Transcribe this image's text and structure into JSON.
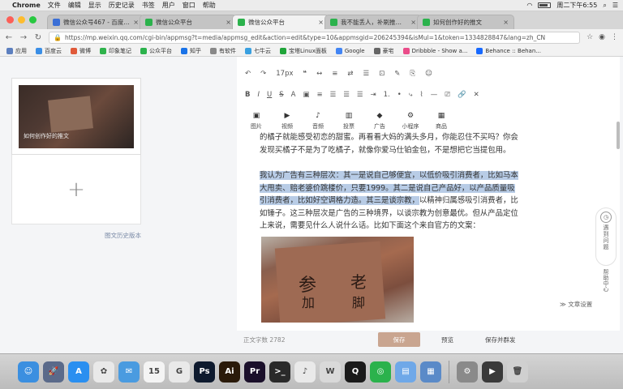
{
  "menubar": {
    "apple": "",
    "items": [
      "Chrome",
      "文件",
      "编辑",
      "显示",
      "历史记录",
      "书签",
      "用户",
      "窗口",
      "帮助"
    ],
    "clock": "周二下午6:55"
  },
  "tabs": [
    {
      "title": "微信公众号467 - 百度翻译"
    },
    {
      "title": "微信公众平台"
    },
    {
      "title": "微信公众平台"
    },
    {
      "title": "我不能丢人，补刷推荐的书单"
    },
    {
      "title": "如何创作好的推文"
    }
  ],
  "address": {
    "url": "https://mp.weixin.qq.com/cgi-bin/appmsg?t=media/appmsg_edit&action=edit&type=10&appmsgid=206245394&isMul=1&token=1334828847&lang=zh_CN"
  },
  "bookmarks": [
    "应用",
    "百度云",
    "微博",
    "印象笔记",
    "公众平台",
    "知乎",
    "有软件",
    "七牛云",
    "宝塔Linux面板",
    "Google",
    "豪宅",
    "Dribbble - Show a...",
    "Behance :: Behan..."
  ],
  "left": {
    "cover_caption": "如何创作好的推文",
    "add_symbol": "+",
    "history_link": "图文历史版本"
  },
  "toolbar": {
    "row1": [
      "↶",
      "↷",
      "17px",
      "❝",
      "↔",
      "≡",
      "⇄",
      "☰",
      "⊡",
      "✎",
      "⎘",
      "☺"
    ],
    "row2": [
      "B",
      "I",
      "U",
      "S",
      "A",
      "▣",
      "≡",
      "☰",
      "☰",
      "☰",
      "⇥",
      "1.",
      "•",
      "⤷",
      "⌇",
      "—",
      "⎚",
      "🔗",
      "✕"
    ],
    "media": [
      {
        "icon": "▣",
        "label": "图片"
      },
      {
        "icon": "▶",
        "label": "视频"
      },
      {
        "icon": "♪",
        "label": "音频"
      },
      {
        "icon": "▥",
        "label": "投票"
      },
      {
        "icon": "◆",
        "label": "广告"
      },
      {
        "icon": "⚙",
        "label": "小程序"
      },
      {
        "icon": "▦",
        "label": "商品"
      }
    ]
  },
  "content": {
    "para1": "的橘子就能感受初恋的甜蜜。再看看大妈的满头多月，你能忍住不买吗？你会发现买橘子不是为了吃橘子，就像你爱马仕铂金包，不是想把它当提包用。",
    "para2_selected": "我认为广告有三种层次：其一是说自己够便宜，以低价吸引消费者，比如马本大甩卖、赔老婆价跳楼价，只要1999。其二是说自己产品好，以产品质量吸引消费者，比如好空调格力造。其三是谈宗教，",
    "para2_rest": "以精神归属感吸引消费者，比如锤子。这三种层次是广告的三种境界，以谈宗教为创意最优。但从产品定位上来说，需要见什么人说什么话。比如下面这个来自官方的文案：",
    "image_chars": [
      "参",
      "老",
      "加",
      "脚"
    ]
  },
  "side_widget": {
    "icon": "◷",
    "label": "遇到问题",
    "help": "帮助中心"
  },
  "doc_settings": "≫ 文章设置",
  "footer": {
    "word_count": "正文字数 2782",
    "save": "保存",
    "preview": "预览",
    "publish": "保存并群发"
  },
  "dock": [
    {
      "name": "finder",
      "glyph": "☺",
      "color": "#3b8fe0"
    },
    {
      "name": "launchpad",
      "glyph": "🚀",
      "color": "#5a6a8a"
    },
    {
      "name": "app-store",
      "glyph": "A",
      "color": "#2a8ff0"
    },
    {
      "name": "photos",
      "glyph": "✿",
      "color": "#e9e9e9"
    },
    {
      "name": "mail",
      "glyph": "✉",
      "color": "#4a9be0"
    },
    {
      "name": "calendar",
      "glyph": "15",
      "color": "#f4f4f4"
    },
    {
      "name": "chrome",
      "glyph": "G",
      "color": "#e9e9e9"
    },
    {
      "name": "photoshop",
      "glyph": "Ps",
      "color": "#0e1a2e"
    },
    {
      "name": "illustrator",
      "glyph": "Ai",
      "color": "#2a1a0a"
    },
    {
      "name": "premiere",
      "glyph": "Pr",
      "color": "#1a0f2a"
    },
    {
      "name": "terminal",
      "glyph": ">_",
      "color": "#2a2a2a"
    },
    {
      "name": "music",
      "glyph": "♪",
      "color": "#e9e9e9"
    },
    {
      "name": "wps",
      "glyph": "W",
      "color": "#d9d9d9"
    },
    {
      "name": "qq",
      "glyph": "Q",
      "color": "#1a1a1a"
    },
    {
      "name": "wechat",
      "glyph": "◎",
      "color": "#2bb24c"
    },
    {
      "name": "folder",
      "glyph": "▤",
      "color": "#6fa8e8"
    },
    {
      "name": "preview",
      "glyph": "▦",
      "color": "#5a8ac8"
    },
    {
      "name": "system-prefs",
      "glyph": "⚙",
      "color": "#8a8a8a"
    },
    {
      "name": "quicktime",
      "glyph": "▶",
      "color": "#3a3a3a"
    },
    {
      "name": "trash",
      "glyph": "🗑",
      "color": "#d0d0d0"
    }
  ]
}
